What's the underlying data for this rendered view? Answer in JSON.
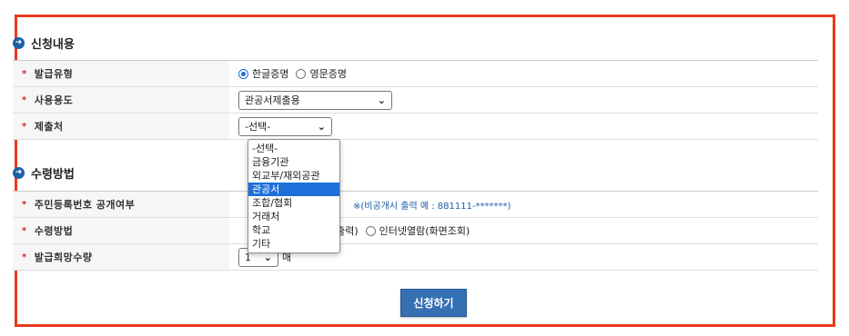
{
  "section1": {
    "title": "신청내용",
    "icon": "arrow-right-circle-icon"
  },
  "section2": {
    "title": "수령방법",
    "icon": "arrow-right-circle-icon"
  },
  "fields": {
    "issue_type": {
      "label": "발급유형",
      "options": [
        {
          "label": "한글증명",
          "checked": true
        },
        {
          "label": "영문증명",
          "checked": false
        }
      ]
    },
    "usage": {
      "label": "사용용도",
      "selected": "관공서제출용"
    },
    "submit_to": {
      "label": "제출처",
      "selected": "-선택-"
    },
    "id_disclosure": {
      "label": "주민등록번호 공개여부",
      "note": "※(비공개시 출력 예 : 881111-*******)"
    },
    "receive_method": {
      "label": "수령방법",
      "visible_text": "서출력)",
      "option2": "인터넷열람(화면조회)"
    },
    "quantity": {
      "label": "발급희망수량",
      "selected": "1",
      "unit": "매"
    }
  },
  "dropdown": {
    "options": [
      "-선택-",
      "금융기관",
      "외교부/재외공관",
      "관공서",
      "조합/협회",
      "거래처",
      "학교",
      "기타"
    ],
    "highlighted": "관공서"
  },
  "submit_label": "신청하기",
  "colors": {
    "frame_border": "#e63a1c",
    "accent": "#1e5fa6",
    "required": "#d2232a",
    "highlight": "#1e6fd9"
  }
}
